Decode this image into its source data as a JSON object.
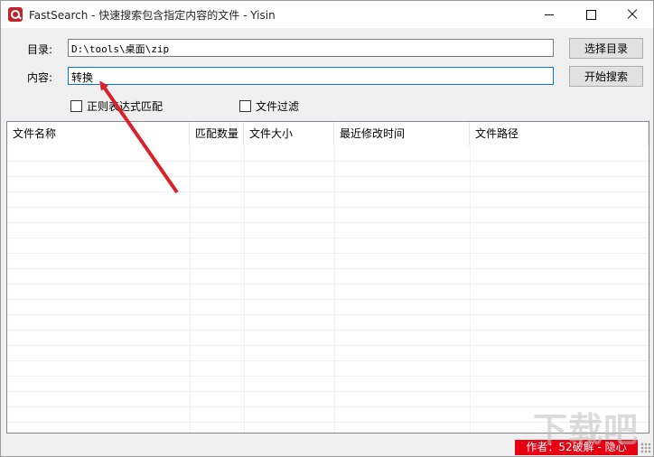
{
  "window": {
    "title": "FastSearch - 快速搜索包含指定内容的文件 - Yisin"
  },
  "form": {
    "dir_label": "目录:",
    "dir_value": "D:\\tools\\桌面\\zip",
    "content_label": "内容:",
    "content_value": "转换",
    "browse_button": "选择目录",
    "search_button": "开始搜索",
    "regex_checkbox": "正则表达式匹配",
    "filter_checkbox": "文件过滤"
  },
  "table": {
    "columns": [
      "文件名称",
      "匹配数量",
      "文件大小",
      "最近修改时间",
      "文件路径"
    ]
  },
  "status": {
    "author_badge": "作者：52破解 - 隐心"
  },
  "watermark": "下载吧",
  "colors": {
    "badge": "#e60012",
    "arrow": "#d9222a",
    "focus_border": "#0078d7"
  }
}
